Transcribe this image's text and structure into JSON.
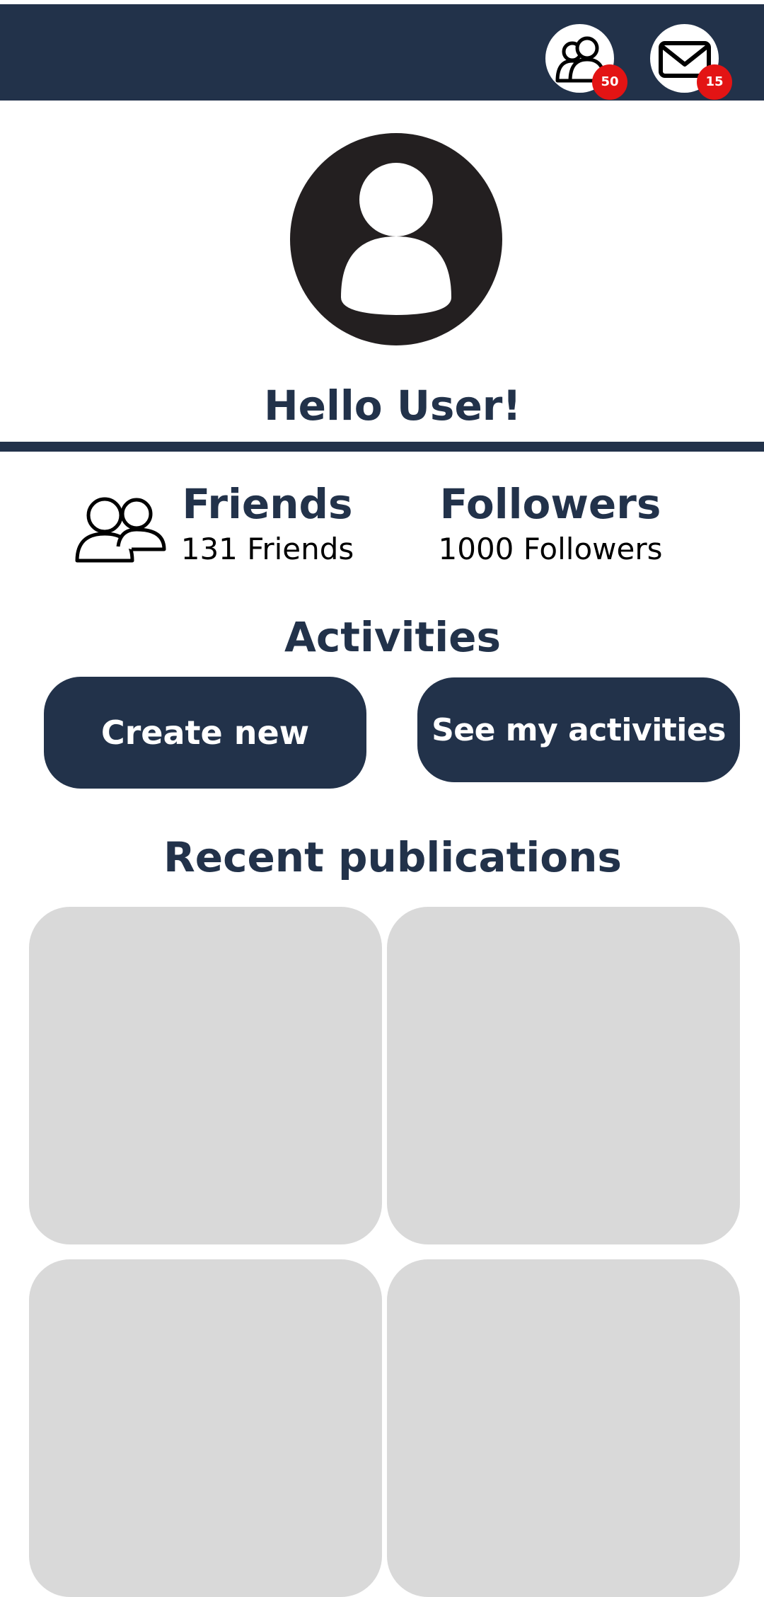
{
  "header": {
    "friends_badge": "50",
    "messages_badge": "15",
    "friends_icon": "users-icon",
    "messages_icon": "mail-icon"
  },
  "profile": {
    "avatar_icon": "user-avatar-icon",
    "greeting": "Hello User!"
  },
  "stats": {
    "icon": "users-icon",
    "friends_title": "Friends",
    "friends_value": "131 Friends",
    "followers_title": "Followers",
    "followers_value": "1000 Followers"
  },
  "activities": {
    "title": "Activities",
    "create_label": "Create new",
    "see_label": "See my activities"
  },
  "recent": {
    "title": "Recent publications"
  },
  "colors": {
    "primary": "#22324a",
    "badge": "#e31414",
    "avatar": "#231f20",
    "placeholder": "#d9d9d9",
    "background": "#ffffff"
  }
}
